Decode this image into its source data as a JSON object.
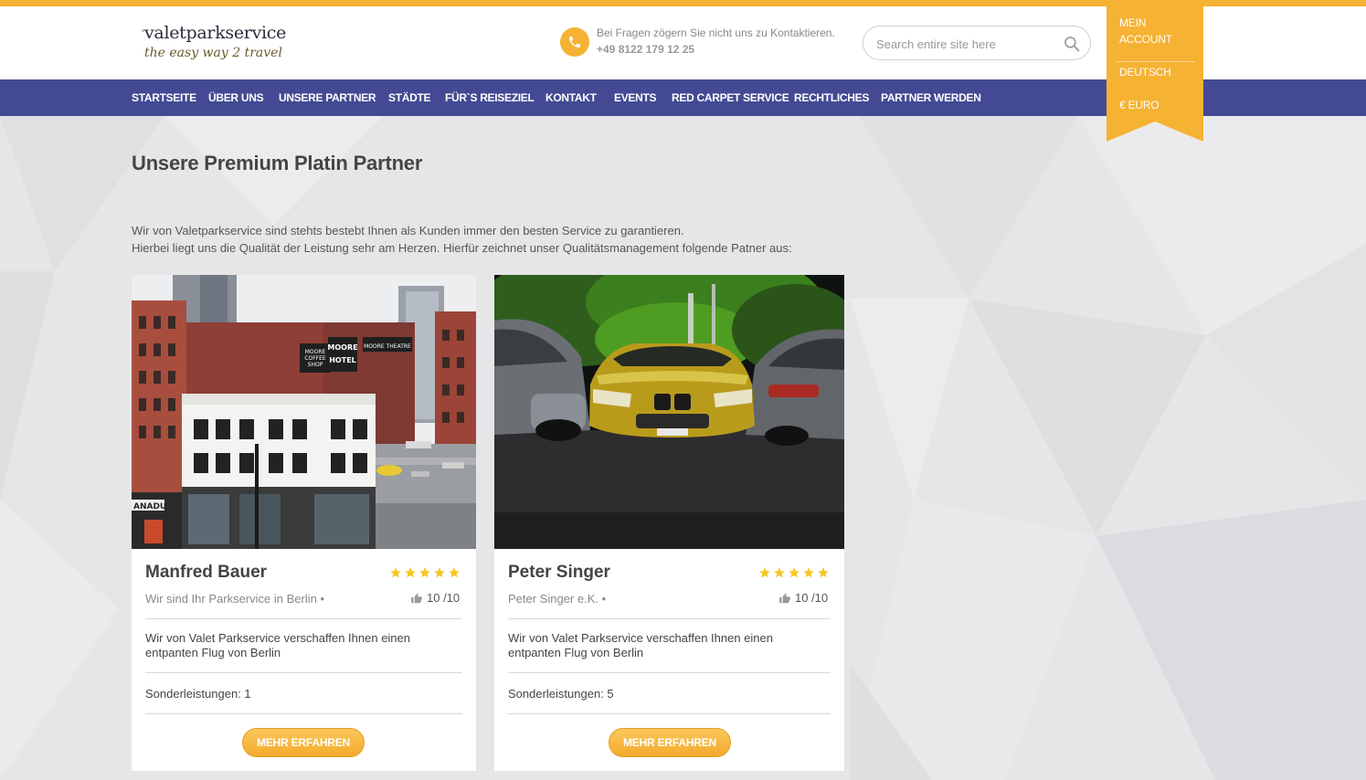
{
  "colors": {
    "accent": "#f6b233",
    "nav_bg": "#434a93",
    "page_bg": "#e6e6e8",
    "star": "#f6c624"
  },
  "logo": {
    "line1": "valetparkservice",
    "line2": "the easy way 2 travel"
  },
  "contact": {
    "icon": "phone-icon",
    "question": "Bei Fragen zögern Sie nicht uns zu Kontaktieren.",
    "phone": "+49 8122 179 12 25"
  },
  "search": {
    "placeholder": "Search entire site here",
    "icon": "search-icon"
  },
  "nav": {
    "items": [
      "STARTSEITE",
      "ÜBER UNS",
      "UNSERE PARTNER",
      "STÄDTE",
      "FÜR`S REISEZIEL",
      "KONTAKT",
      "EVENTS",
      "RED CARPET SERVICE",
      "RECHTLICHES",
      "PARTNER WERDEN"
    ]
  },
  "ribbon": {
    "account_line1": "MEIN",
    "account_line2": "ACCOUNT",
    "language": "DEUTSCH",
    "currency": "€ EURO"
  },
  "main": {
    "title": "Unsere Premium Platin Partner",
    "intro_line1": "Wir von Valetparkservice sind stehts bestebt Ihnen als Kunden immer den besten Service zu garantieren.",
    "intro_line2": "Hierbei liegt uns die Qualität der Leistung sehr am Herzen. Hierfür zeichnet unser Qualitätsmanagement folgende Patner aus:"
  },
  "cards": [
    {
      "name": "Manfred Bauer",
      "stars": 5,
      "subtitle": "Wir sind Ihr Parkservice in Berlin •",
      "rating": "10 /10",
      "description_line1": "Wir von Valet Parkservice verschaffen Ihnen einen",
      "description_line2": "entpanten Flug von Berlin",
      "extras": "Sonderleistungen: 1",
      "button": "MEHR ERFAHREN",
      "image_signs": {
        "coffee_1": "MOORE",
        "coffee_2": "COFFEE",
        "coffee_3": "SHOP",
        "hotel_1": "MOORE",
        "hotel_2": "HOTEL",
        "theatre": "MOORE THEATRE",
        "store": "ANADU"
      }
    },
    {
      "name": "Peter Singer",
      "stars": 5,
      "subtitle": "Peter Singer e.K. •",
      "rating": "10 /10",
      "description_line1": "Wir von Valet Parkservice verschaffen Ihnen einen",
      "description_line2": "entpanten Flug von Berlin",
      "extras": "Sonderleistungen: 5",
      "button": "MEHR ERFAHREN"
    }
  ]
}
